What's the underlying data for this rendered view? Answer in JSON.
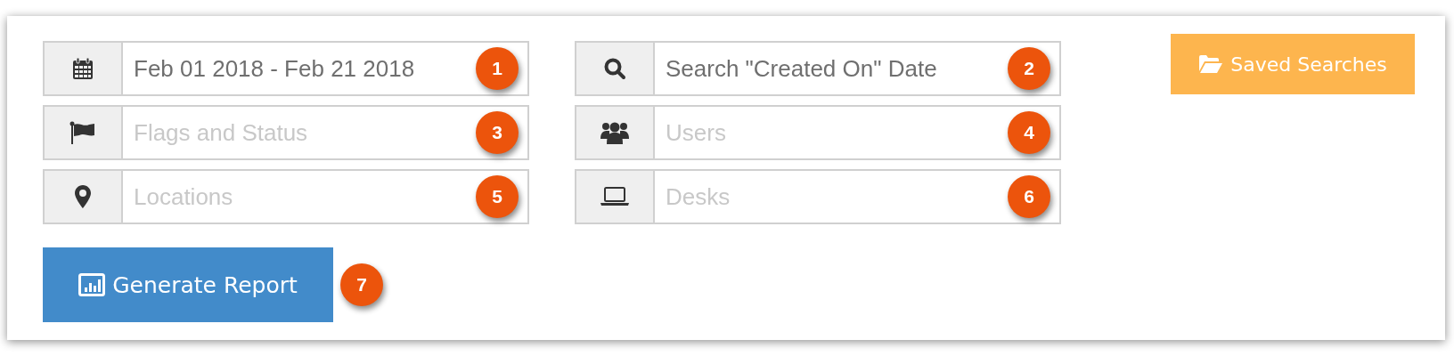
{
  "filters": [
    {
      "value": "Feb 01 2018 - Feb 21 2018",
      "badge": "1"
    },
    {
      "value": "Search \"Created On\" Date",
      "badge": "2"
    },
    {
      "placeholder": "Flags and Status",
      "badge": "3"
    },
    {
      "placeholder": "Users",
      "badge": "4"
    },
    {
      "placeholder": "Locations",
      "badge": "5"
    },
    {
      "placeholder": "Desks",
      "badge": "6"
    }
  ],
  "saved_searches_button": "Saved Searches",
  "generate_button": {
    "label": "Generate Report",
    "badge": "7"
  }
}
